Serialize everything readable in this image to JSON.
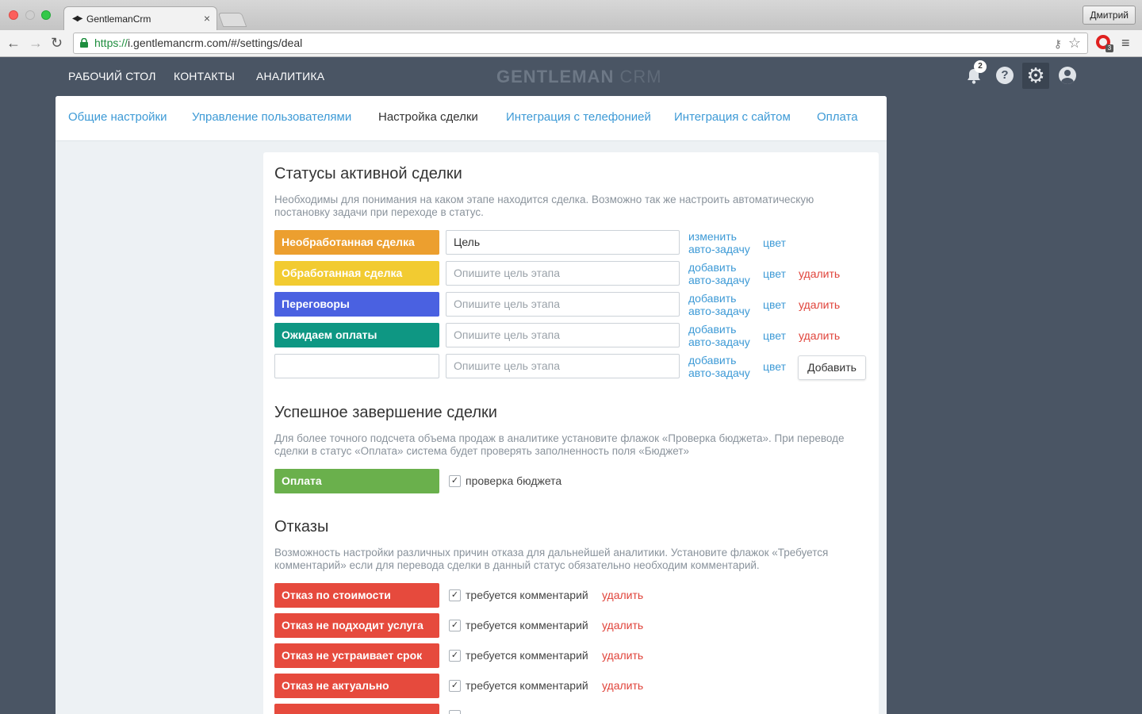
{
  "browser": {
    "tab_title": "GentlemanCrm",
    "tab_close": "×",
    "user_button": "Дмитрий",
    "url_scheme": "https://",
    "url_rest": "i.gentlemancrm.com/#/settings/deal",
    "opera_badge": "3"
  },
  "header": {
    "nav": [
      "РАБОЧИЙ СТОЛ",
      "КОНТАКТЫ",
      "АНАЛИТИКА"
    ],
    "logo_main": "GENTLEMAN",
    "logo_suffix": " CRM",
    "notification_count": "2",
    "help_glyph": "?"
  },
  "settings_tabs": {
    "items": [
      "Общие настройки",
      "Управление пользователями",
      "Настройка сделки",
      "Интеграция с телефонией",
      "Интеграция с сайтом",
      "Оплата"
    ],
    "active_index": 2
  },
  "active_statuses": {
    "title": "Статусы активной сделки",
    "description": "Необходимы для понимания на каком этапе находится сделка. Возможно так же настроить автоматическую постановку задачи при переходе в статус.",
    "rows": [
      {
        "name": "Необработанная сделка",
        "color": "#ec9f2f",
        "goal": "Цель",
        "goal_placeholder": "",
        "task_action": "изменить",
        "task_object": "авто-задачу",
        "color_link": "цвет",
        "delete": ""
      },
      {
        "name": "Обработанная сделка",
        "color": "#f2cb31",
        "goal": "",
        "goal_placeholder": "Опишите цель этапа",
        "task_action": "добавить",
        "task_object": "авто-задачу",
        "color_link": "цвет",
        "delete": "удалить"
      },
      {
        "name": "Переговоры",
        "color": "#4a61e1",
        "goal": "",
        "goal_placeholder": "Опишите цель этапа",
        "task_action": "добавить",
        "task_object": "авто-задачу",
        "color_link": "цвет",
        "delete": "удалить"
      },
      {
        "name": "Ожидаем оплаты",
        "color": "#0e9783",
        "goal": "",
        "goal_placeholder": "Опишите цель этапа",
        "task_action": "добавить",
        "task_object": "авто-задачу",
        "color_link": "цвет",
        "delete": "удалить"
      }
    ],
    "new_row": {
      "name": "",
      "goal_placeholder": "Опишите цель этапа",
      "task_action": "добавить",
      "task_object": "авто-задачу",
      "color_link": "цвет",
      "add_button": "Добавить"
    }
  },
  "success": {
    "title": "Успешное завершение сделки",
    "description": "Для более точного подсчета объема продаж в аналитике установите флажок «Проверка бюджета». При переводе сделки в статус «Оплата» система будет проверять заполненность поля «Бюджет»",
    "status": {
      "name": "Оплата",
      "color": "#6ab04c"
    },
    "checkbox": {
      "label": "проверка бюджета",
      "checked": true,
      "mark": "✓"
    }
  },
  "rejections": {
    "title": "Отказы",
    "description": "Возможность настройки различных причин отказа для дальнейшей аналитики. Установите флажок «Требуется комментарий» если для перевода сделки в данный статус обязательно необходим комментарий.",
    "color": "#e64a3d",
    "rows": [
      {
        "name": "Отказ по стоимости",
        "checkbox_label": "требуется комментарий",
        "checked": true,
        "mark": "✓",
        "delete": "удалить"
      },
      {
        "name": "Отказ не подходит услуга",
        "checkbox_label": "требуется комментарий",
        "checked": true,
        "mark": "✓",
        "delete": "удалить"
      },
      {
        "name": "Отказ не устраивает срок",
        "checkbox_label": "требуется комментарий",
        "checked": true,
        "mark": "✓",
        "delete": "удалить"
      },
      {
        "name": "Отказ не актуально",
        "checkbox_label": "требуется комментарий",
        "checked": true,
        "mark": "✓",
        "delete": "удалить"
      }
    ]
  }
}
